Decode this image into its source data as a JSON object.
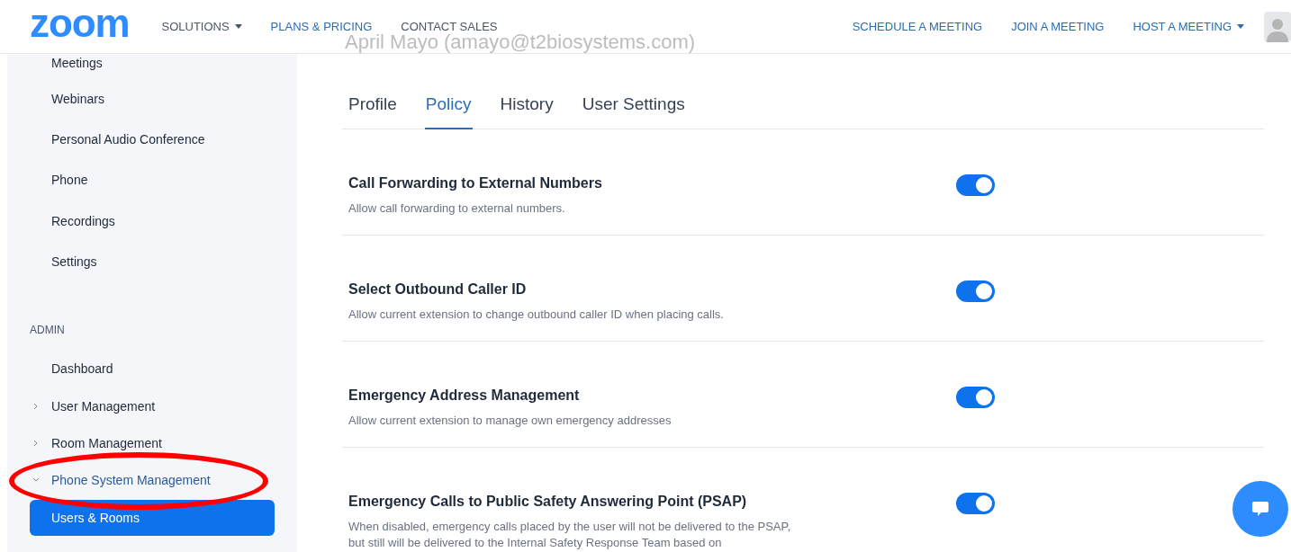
{
  "header": {
    "logo": "zoom",
    "nav_left": [
      {
        "label": "SOLUTIONS",
        "dropdown": true,
        "highlighted": false
      },
      {
        "label": "PLANS & PRICING",
        "dropdown": false,
        "highlighted": true
      },
      {
        "label": "CONTACT SALES",
        "dropdown": false,
        "highlighted": false
      }
    ],
    "nav_right": [
      {
        "label": "SCHEDULE A MEETING",
        "dropdown": false
      },
      {
        "label": "JOIN A MEETING",
        "dropdown": false
      },
      {
        "label": "HOST A MEETING",
        "dropdown": true
      }
    ],
    "faded_title": "April Mayo (amayo@t2biosystems.com)"
  },
  "sidebar": {
    "items": [
      {
        "label": "Meetings",
        "kind": "link",
        "selected": false
      },
      {
        "label": "Webinars",
        "kind": "link",
        "selected": false
      },
      {
        "label": "Personal Audio Conference",
        "kind": "link",
        "selected": false
      },
      {
        "label": "Phone",
        "kind": "link",
        "selected": false
      },
      {
        "label": "Recordings",
        "kind": "link",
        "selected": false
      },
      {
        "label": "Settings",
        "kind": "link",
        "selected": false
      },
      {
        "label": "ADMIN",
        "kind": "heading",
        "selected": false
      },
      {
        "label": "Dashboard",
        "kind": "link",
        "selected": false
      },
      {
        "label": "User Management",
        "kind": "group",
        "expanded": false,
        "selected": false
      },
      {
        "label": "Room Management",
        "kind": "group",
        "expanded": false,
        "selected": false
      },
      {
        "label": "Phone System Management",
        "kind": "group",
        "expanded": true,
        "selected": false
      },
      {
        "label": "Users & Rooms",
        "kind": "link",
        "selected": true
      }
    ]
  },
  "tabs": [
    {
      "label": "Profile",
      "selected": false
    },
    {
      "label": "Policy",
      "selected": true
    },
    {
      "label": "History",
      "selected": false
    },
    {
      "label": "User Settings",
      "selected": false
    }
  ],
  "settings": [
    {
      "title": "Call Forwarding to External Numbers",
      "description": "Allow call forwarding to external numbers.",
      "on": true
    },
    {
      "title": "Select Outbound Caller ID",
      "description": "Allow current extension to change outbound caller ID when placing calls.",
      "on": true
    },
    {
      "title": "Emergency Address Management",
      "description": "Allow current extension to manage own emergency addresses",
      "on": true
    },
    {
      "title": "Emergency Calls to Public Safety Answering Point (PSAP)",
      "description": "When disabled, emergency calls placed by the user will not be delivered to the PSAP, but still will be delivered to the Internal Safety Response Team based on",
      "on": true
    }
  ]
}
